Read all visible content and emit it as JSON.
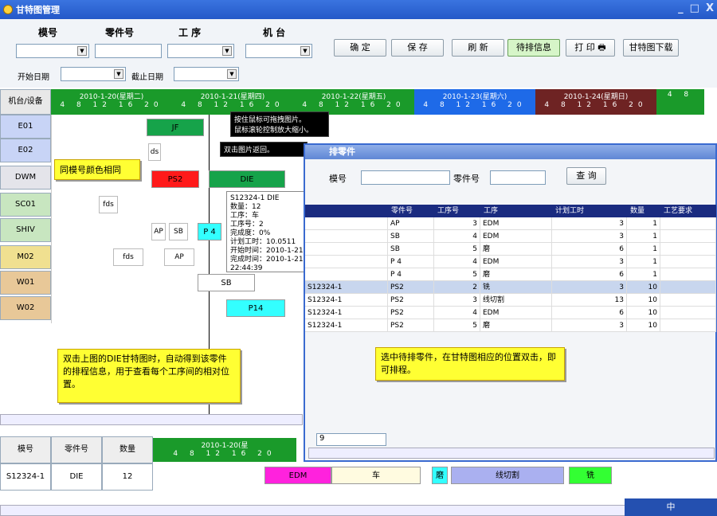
{
  "window": {
    "title": "甘特图管理",
    "btns": [
      "_",
      "□",
      "X"
    ]
  },
  "toolbar": {
    "labels": [
      "模号",
      "零件号",
      "工 序",
      "机 台"
    ],
    "buttons": [
      "确 定",
      "保 存",
      "刷 新",
      "待排信息",
      "打 印",
      "甘特图下载"
    ],
    "start_label": "开始日期",
    "end_label": "截止日期"
  },
  "gantt": {
    "corner": "机台/设备",
    "days": [
      {
        "date": "2010-1-20(星期二)",
        "hours": "4 8 12 16 20",
        "color": "#1a9a2a"
      },
      {
        "date": "2010-1-21(星期四)",
        "hours": "4 8 12 16 20",
        "color": "#1a9a2a"
      },
      {
        "date": "2010-1-22(星期五)",
        "hours": "4 8 12 16 20",
        "color": "#1a9a2a"
      },
      {
        "date": "2010-1-23(星期六)",
        "hours": "4 8 12 16 20",
        "color": "#1e6ae8"
      },
      {
        "date": "2010-1-24(星期日)",
        "hours": "4 8 12 16 20",
        "color": "#6e2323"
      },
      {
        "date": "",
        "hours": "4 8",
        "color": "#1a9a2a"
      }
    ],
    "machines": [
      "E01",
      "E02",
      "DWM",
      "SC01",
      "SHIV",
      "M02",
      "W01",
      "W02"
    ],
    "bars": {
      "e01": "JF",
      "dwm_ps2": "PS2",
      "dwm_die": "DIE",
      "shiv_p4": "P 4",
      "w01_sb": "SB",
      "w02_p14": "P14"
    },
    "smalls": {
      "e02": "ds",
      "sc01": "fds",
      "shiv_ap": "AP",
      "shiv_sb": "SB",
      "m02_fds": "fds",
      "m02_ap": "AP"
    },
    "tips": {
      "t1": "按住鼠标可拖拽图片。",
      "t2": "鼠标滚轮控制放大缩小。",
      "t3": "双击图片返回。"
    },
    "callouts": {
      "c1": "同模号颜色相同",
      "c2": "双击上图的DIE甘特图时，自动得到该零件的排程信息，用于查看每个工序间的相对位置。",
      "c3": "选中待排零件，在甘特图相应的位置双击，即可排程。"
    },
    "info": [
      "S12324-1 DIE",
      "数量：12",
      "工序：车",
      "工序号：2",
      "完成度：0%",
      "计划工时：10.0511",
      "开始时间：2010-1-21 6:41:5",
      "完成时间：2010-1-21 22:44:39"
    ]
  },
  "sub": {
    "title": "排零件",
    "label_mold": "模号",
    "label_part": "零件号",
    "query": "查 询",
    "headers": [
      "零件号",
      "工序号",
      "工序",
      "计划工时",
      "数量",
      "工艺要求"
    ],
    "rows": [
      [
        "",
        "AP",
        "3",
        "EDM",
        "3",
        "1"
      ],
      [
        "",
        "SB",
        "4",
        "EDM",
        "3",
        "1"
      ],
      [
        "",
        "SB",
        "5",
        "磨",
        "6",
        "1"
      ],
      [
        "",
        "P 4",
        "4",
        "EDM",
        "3",
        "1"
      ],
      [
        "",
        "P 4",
        "5",
        "磨",
        "6",
        "1"
      ],
      [
        "S12324-1",
        "PS2",
        "2",
        "铣",
        "3",
        "10"
      ],
      [
        "S12324-1",
        "PS2",
        "3",
        "线切割",
        "13",
        "10"
      ],
      [
        "S12324-1",
        "PS2",
        "4",
        "EDM",
        "6",
        "10"
      ],
      [
        "S12324-1",
        "PS2",
        "5",
        "磨",
        "3",
        "10"
      ]
    ],
    "count": "9"
  },
  "bottom": {
    "headers": [
      "模号",
      "零件号",
      "数量"
    ],
    "row": [
      "S12324-1",
      "DIE",
      "12"
    ],
    "day": "2010-1-20(星",
    "hours": "4 8 12 16 20",
    "ops": [
      "EDM",
      "车",
      "磨",
      "线切割",
      "铣"
    ]
  },
  "colors": {
    "header_green": "#1a9a2a",
    "ps2_red": "#ff1a1a",
    "die_green": "#16a34a",
    "yellow": "#ffff33",
    "magenta": "#ff22dd",
    "cyan": "#33ffff"
  }
}
